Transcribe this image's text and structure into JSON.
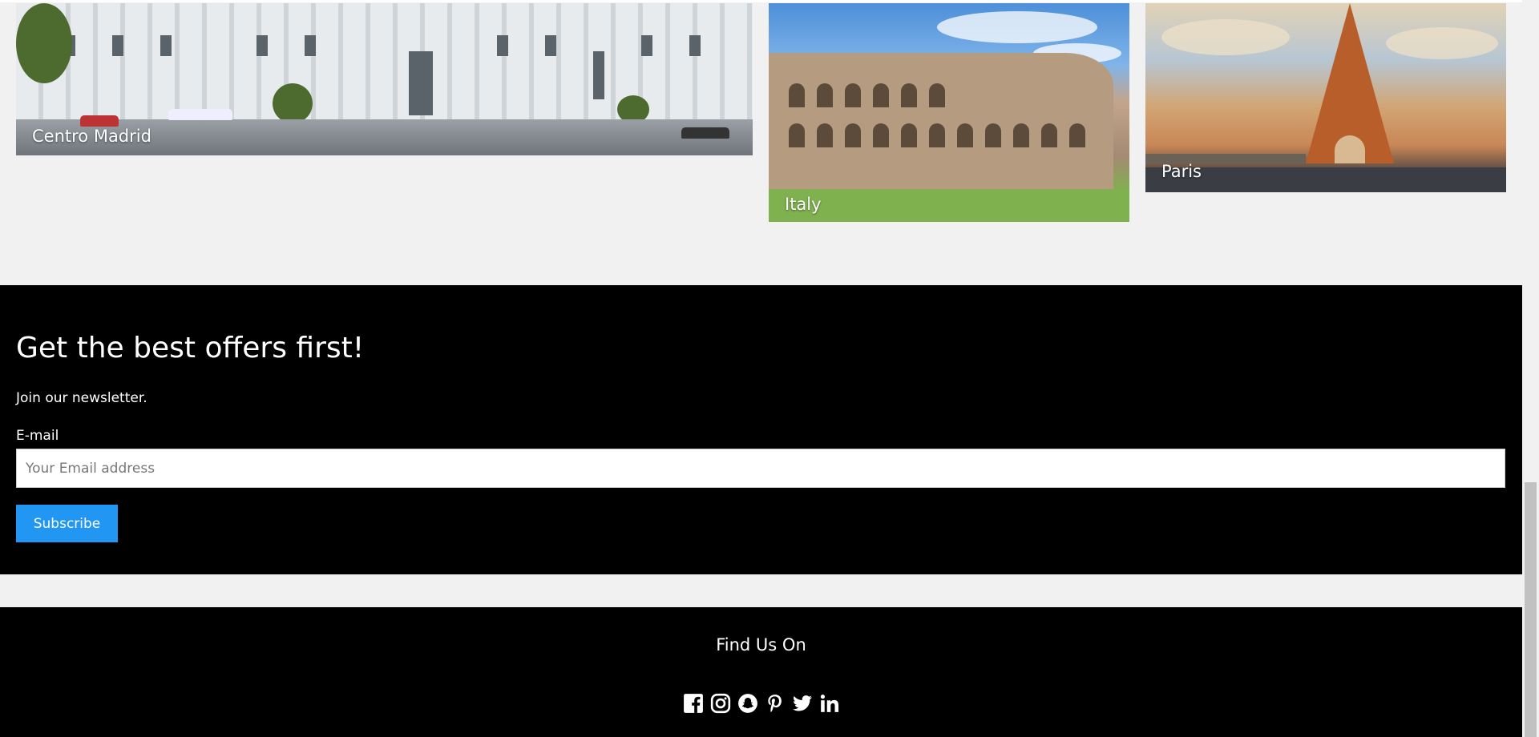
{
  "destinations": [
    {
      "caption": "Centro Madrid"
    },
    {
      "caption": "Italy"
    },
    {
      "caption": "Paris"
    }
  ],
  "newsletter": {
    "title": "Get the best offers first!",
    "subtitle": "Join our newsletter.",
    "email_label": "E-mail",
    "email_placeholder": "Your Email address",
    "email_value": "",
    "subscribe_label": "Subscribe"
  },
  "footer": {
    "title": "Find Us On",
    "socials": [
      "facebook-icon",
      "instagram-icon",
      "snapchat-icon",
      "pinterest-icon",
      "twitter-icon",
      "linkedin-icon"
    ]
  },
  "colors": {
    "background": "#f1f1f1",
    "dark_section": "#000000",
    "button": "#2196f3",
    "text_on_dark": "#ffffff"
  }
}
